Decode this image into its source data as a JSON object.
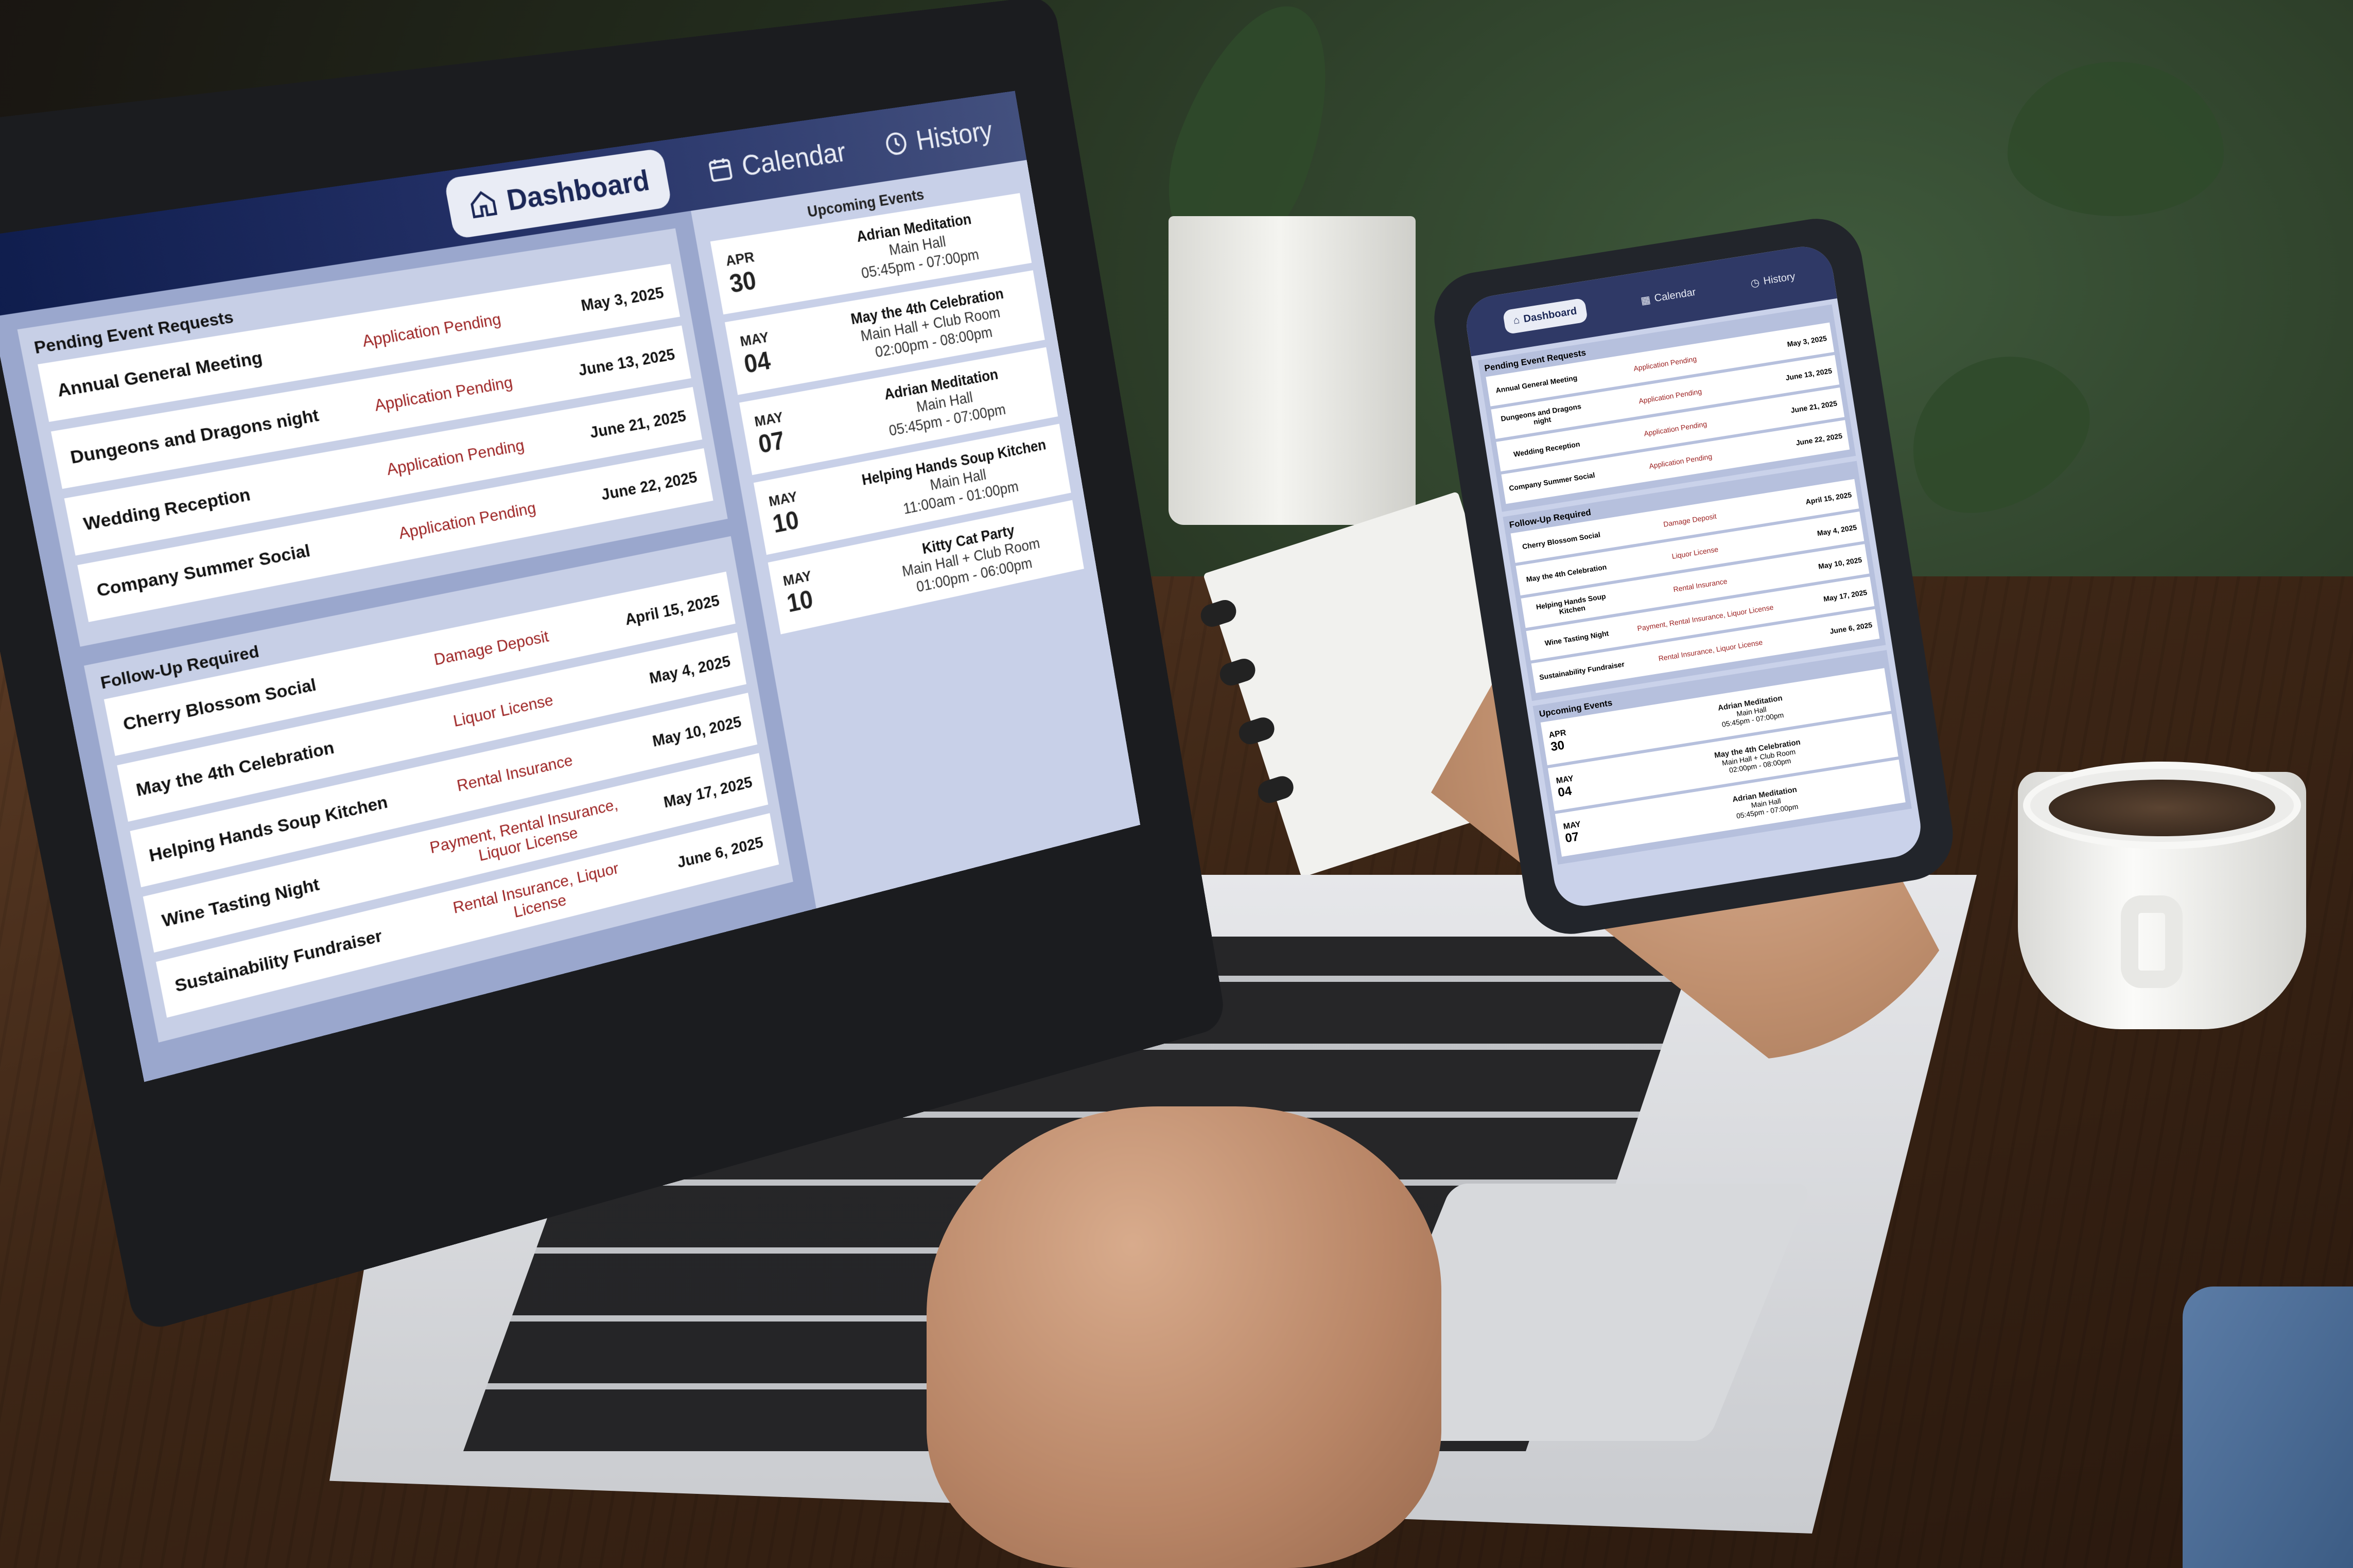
{
  "nav": {
    "tabs": [
      {
        "label": "Dashboard",
        "icon": "home-icon",
        "active": true
      },
      {
        "label": "Calendar",
        "icon": "calendar-icon",
        "active": false
      },
      {
        "label": "History",
        "icon": "clock-icon",
        "active": false
      }
    ]
  },
  "pending": {
    "title": "Pending Event Requests",
    "rows": [
      {
        "name": "Annual General Meeting",
        "status": "Application Pending",
        "date": "May 3, 2025"
      },
      {
        "name": "Dungeons and Dragons night",
        "status": "Application Pending",
        "date": "June 13, 2025"
      },
      {
        "name": "Wedding Reception",
        "status": "Application Pending",
        "date": "June 21, 2025"
      },
      {
        "name": "Company Summer Social",
        "status": "Application Pending",
        "date": "June 22, 2025"
      }
    ]
  },
  "followup": {
    "title": "Follow-Up Required",
    "rows": [
      {
        "name": "Cherry Blossom Social",
        "status": "Damage Deposit",
        "date": "April 15, 2025"
      },
      {
        "name": "May the 4th Celebration",
        "status": "Liquor License",
        "date": "May 4, 2025"
      },
      {
        "name": "Helping Hands Soup Kitchen",
        "status": "Rental Insurance",
        "date": "May 10, 2025"
      },
      {
        "name": "Wine Tasting  Night",
        "status": "Payment, Rental Insurance, Liquor License",
        "date": "May 17, 2025"
      },
      {
        "name": "Sustainability Fundraiser",
        "status": "Rental Insurance, Liquor License",
        "date": "June 6, 2025"
      }
    ]
  },
  "upcoming": {
    "title": "Upcoming Events",
    "events": [
      {
        "month": "APR",
        "day": "30",
        "name": "Adrian Meditation",
        "room": "Main Hall",
        "time": "05:45pm - 07:00pm"
      },
      {
        "month": "MAY",
        "day": "04",
        "name": "May the 4th Celebration",
        "room": "Main Hall + Club Room",
        "time": "02:00pm - 08:00pm"
      },
      {
        "month": "MAY",
        "day": "07",
        "name": "Adrian Meditation",
        "room": "Main Hall",
        "time": "05:45pm - 07:00pm"
      },
      {
        "month": "MAY",
        "day": "10",
        "name": "Helping Hands Soup Kitchen",
        "room": "Main Hall",
        "time": "11:00am - 01:00pm"
      },
      {
        "month": "MAY",
        "day": "10",
        "name": "Kitty Cat Party",
        "room": "Main Hall + Club Room",
        "time": "01:00pm - 06:00pm"
      }
    ]
  },
  "colors": {
    "nav_dark": "#0f1d4d",
    "accent_red": "#9b1f1f",
    "panel": "#9aa7cd",
    "panel_light": "#c8d0e8"
  }
}
